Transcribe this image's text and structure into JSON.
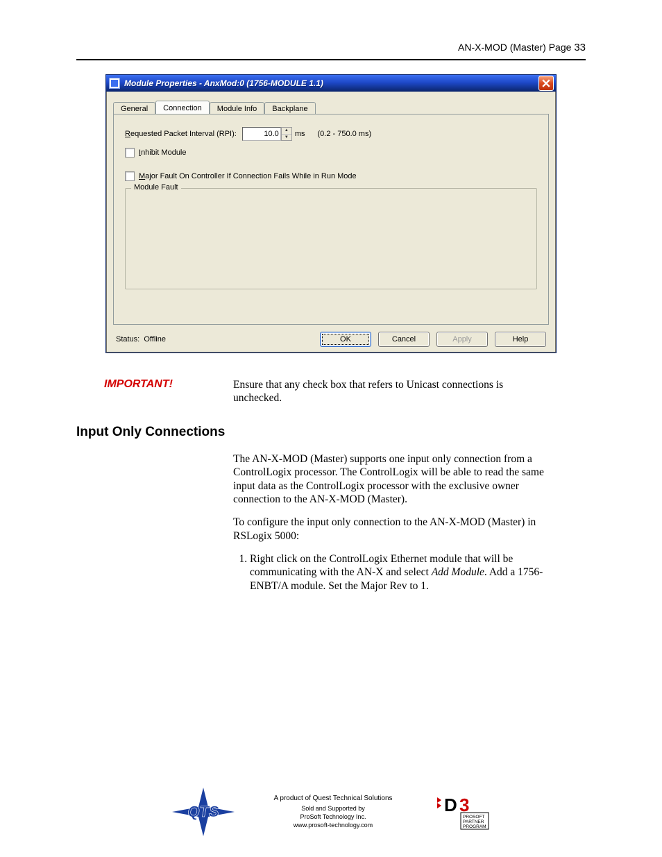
{
  "header": {
    "product": "AN-X-MOD (Master)",
    "page_label": "Page",
    "page_number": "33"
  },
  "dialog": {
    "title": "Module Properties  - AnxMod:0 (1756-MODULE 1.1)",
    "tabs": {
      "general": "General",
      "connection": "Connection",
      "module_info": "Module Info",
      "backplane": "Backplane"
    },
    "active_tab": "connection",
    "rpi_label_pre": "R",
    "rpi_label_post": "equested Packet Interval (RPI):",
    "rpi_value": "10.0",
    "rpi_unit": "ms",
    "rpi_range": "(0.2 - 750.0 ms)",
    "inhibit_pre": "I",
    "inhibit_post": "nhibit Module",
    "fault_pre": "M",
    "fault_post": "ajor Fault On Controller If Connection Fails While in Run Mode",
    "groupbox": "Module Fault",
    "status_label": "Status:",
    "status_value": "Offline",
    "buttons": {
      "ok": "OK",
      "cancel": "Cancel",
      "apply": "Apply",
      "help": "Help"
    }
  },
  "important": {
    "label": "IMPORTANT!",
    "text": "Ensure that any check box that refers to Unicast connections is unchecked."
  },
  "section": {
    "title": "Input Only Connections",
    "para1": "The AN-X-MOD (Master) supports one input only connection from a ControlLogix processor.  The ControlLogix will be able to read the same input data as the ControlLogix processor with the exclusive owner connection to the AN-X-MOD (Master).",
    "para2": "To configure the input only connection to the AN-X-MOD (Master) in RSLogix 5000:",
    "step1_a": "Right click on the ControlLogix Ethernet module that will be communicating with the AN-X and select ",
    "step1_em": "Add Module",
    "step1_b": ".  Add a 1756-ENBT/A module.  Set the Major Rev to 1."
  },
  "footer": {
    "line1": "A product of Quest Technical Solutions",
    "line2": "Sold and Supported by",
    "line3": "ProSoft Technology Inc.",
    "line4": "www.prosoft-technology.com"
  }
}
